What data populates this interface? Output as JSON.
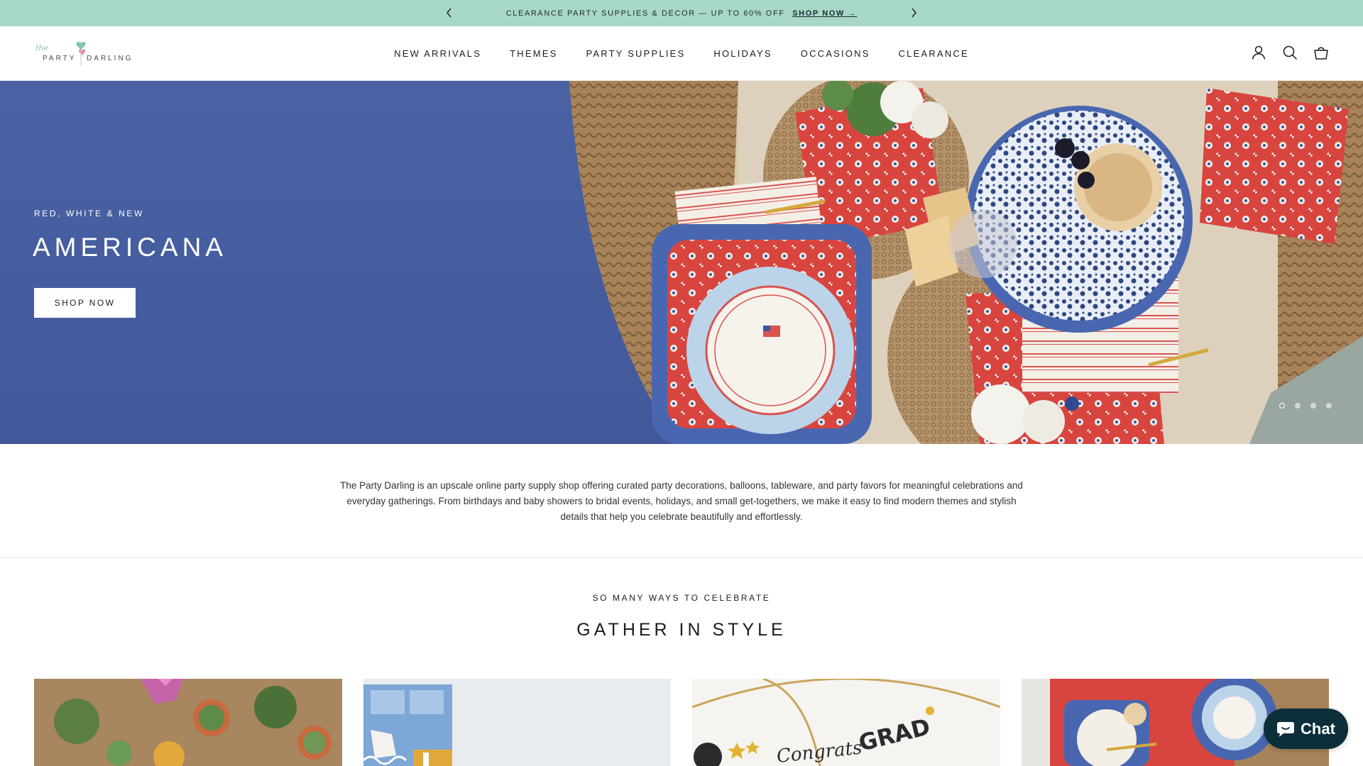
{
  "announcement": {
    "text": "CLEARANCE PARTY SUPPLIES & DECOR — UP TO 60% OFF",
    "link_label": "SHOP NOW →",
    "background": "#a8d8c8"
  },
  "header": {
    "logo": {
      "the": "the",
      "party": "PARTY",
      "darling": "DARLING"
    },
    "nav": [
      "NEW ARRIVALS",
      "THEMES",
      "PARTY SUPPLIES",
      "HOLIDAYS",
      "OCCASIONS",
      "CLEARANCE"
    ],
    "icons": [
      "account-icon",
      "search-icon",
      "cart-icon"
    ]
  },
  "hero": {
    "eyebrow": "RED, WHITE & NEW",
    "title": "AMERICANA",
    "button_label": "SHOP NOW",
    "background": "#47609f",
    "slides_total": 4,
    "active_slide": 1
  },
  "intro": {
    "text": "The Party Darling is an upscale online party supply shop offering curated party decorations, balloons, tableware, and party favors for meaningful celebrations and everyday gatherings. From birthdays and baby showers to bridal events, holidays, and small get-togethers, we make it easy to find modern themes and stylish details that help you celebrate beautifully and effortlessly."
  },
  "celebrate": {
    "eyebrow": "SO MANY WAYS TO CELEBRATE",
    "title": "GATHER IN STYLE",
    "cards": [
      {
        "image": "succulents-table-image"
      },
      {
        "image": "school-supplies-image"
      },
      {
        "image": "congrats-grad-image",
        "overlay_text": "Congrats",
        "overlay_text_2": "GRAD"
      },
      {
        "image": "americana-table-image"
      }
    ]
  },
  "chat": {
    "label": "Chat",
    "background": "#0c2f3a"
  }
}
